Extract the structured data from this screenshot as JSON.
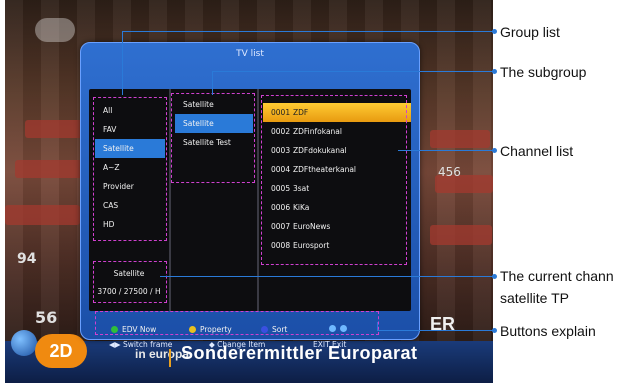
{
  "tv": {
    "channel_logo": "2D",
    "ticker_small": "in europa",
    "ticker_big": "Sonderermittler Europarat",
    "bg_numbers": [
      "56",
      "94",
      "456"
    ],
    "bg_text": "ER"
  },
  "osd": {
    "title": "TV list",
    "group_list": [
      "All",
      "FAV",
      "Satellite",
      "A~Z",
      "Provider",
      "CAS",
      "HD"
    ],
    "group_selected": 2,
    "subgroup": [
      "Satellite",
      "Satellite",
      "Satellite Test"
    ],
    "subgroup_selected": 1,
    "channels": [
      {
        "num": "0001",
        "name": "ZDF"
      },
      {
        "num": "0002",
        "name": "ZDFinfokanal"
      },
      {
        "num": "0003",
        "name": "ZDFdokukanal"
      },
      {
        "num": "0004",
        "name": "ZDFtheaterkanal"
      },
      {
        "num": "0005",
        "name": "3sat"
      },
      {
        "num": "0006",
        "name": "KiKa"
      },
      {
        "num": "0007",
        "name": "EuroNews"
      },
      {
        "num": "0008",
        "name": "Eurosport"
      }
    ],
    "channel_selected": 0,
    "info": {
      "satellite": "Satellite",
      "tp": "3700 / 27500 / H"
    },
    "buttons": [
      {
        "color": "#2fbf3a",
        "label": "EDV Now"
      },
      {
        "color": "#e8c020",
        "label": "Property"
      },
      {
        "color": "#3a50e0",
        "label": "Sort"
      }
    ],
    "helps": [
      {
        "icon": "◀▶",
        "label": "Switch frame"
      },
      {
        "icon": "◆",
        "label": "Change Item"
      },
      {
        "icon": "",
        "label": "EXIT Exit"
      }
    ]
  },
  "callouts": {
    "group_list": "Group list",
    "subgroup": "The subgroup",
    "channel_list": "Channel list",
    "current_channel": "The current chann",
    "satellite_tp": "satellite TP",
    "buttons_explain": "Buttons explain"
  },
  "colors": {
    "accent": "#2a7ad8",
    "highlight": "#ffcc33",
    "dashed_box": "#d040d0"
  }
}
